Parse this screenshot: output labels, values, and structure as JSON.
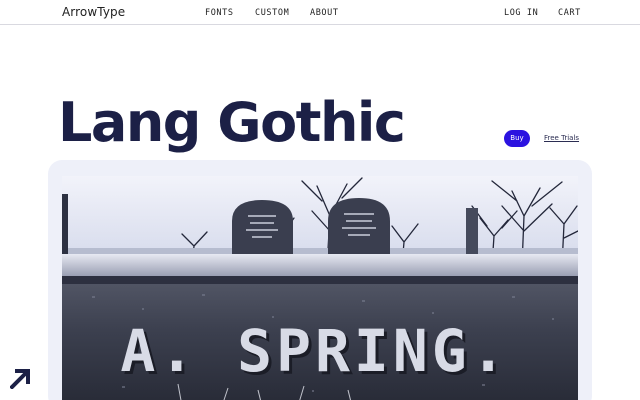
{
  "header": {
    "brand": "ArrowType",
    "nav": {
      "fonts": "FONTS",
      "custom": "CUSTOM",
      "about": "ABOUT"
    },
    "account": {
      "login": "LOG IN",
      "cart": "CART"
    }
  },
  "hero": {
    "title": "Lang Gothic",
    "buy_label": "Buy",
    "trial_label": "Free Trials"
  },
  "showcase": {
    "inscription": "A. SPRING."
  },
  "colors": {
    "accent": "#2b12e0",
    "title": "#1c2046",
    "card_background": "#eef0f9"
  },
  "icons": {
    "corner_logo": "arrow-up-right-icon"
  }
}
